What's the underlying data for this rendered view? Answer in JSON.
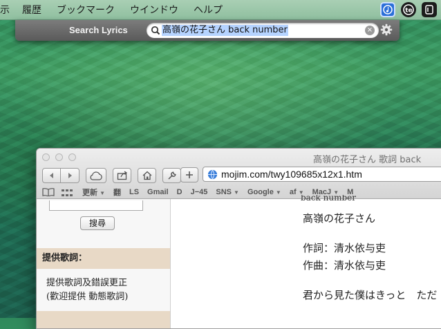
{
  "menubar": {
    "items": [
      "示",
      "履歴",
      "ブックマーク",
      "ウインドウ",
      "ヘルプ"
    ],
    "status_icons": [
      "music-lyrics-icon",
      "te-app-icon",
      "b-app-icon"
    ]
  },
  "lyrics_panel": {
    "title": "Search Lyrics",
    "query": "高嶺の花子さん back number",
    "clear_glyph": "×"
  },
  "browser": {
    "window_title": "高嶺の花子さん 歌詞 back",
    "url": "mojim.com/twy109685x12x1.htm",
    "bookmarks": [
      {
        "label": "更新",
        "menu": true
      },
      {
        "label": "翻",
        "menu": false
      },
      {
        "label": "LS",
        "menu": false
      },
      {
        "label": "Gmail",
        "menu": false
      },
      {
        "label": "D",
        "menu": false
      },
      {
        "label": "J−45",
        "menu": false
      },
      {
        "label": "SNS",
        "menu": true
      },
      {
        "label": "Google",
        "menu": true
      },
      {
        "label": "af",
        "menu": true
      },
      {
        "label": "MacJ",
        "menu": true
      },
      {
        "label": "M",
        "menu": false
      }
    ],
    "sidebar": {
      "search_button": "搜尋",
      "section_heading": "提供歌詞：",
      "section_line1": "提供歌詞及錯誤更正",
      "section_line2": "(歡迎提供 動態歌詞)"
    },
    "lyrics": {
      "cut_line": "back number",
      "song_title": "高嶺の花子さん",
      "lyricist": "作詞：清水依与吏",
      "composer": "作曲：清水依与吏",
      "first_line": "君から見た僕はきっと　ただ"
    }
  },
  "colors": {
    "wallpaper": "#2b7c56",
    "highlight": "#b5d3ff",
    "section_bg": "#e8d9c6"
  }
}
